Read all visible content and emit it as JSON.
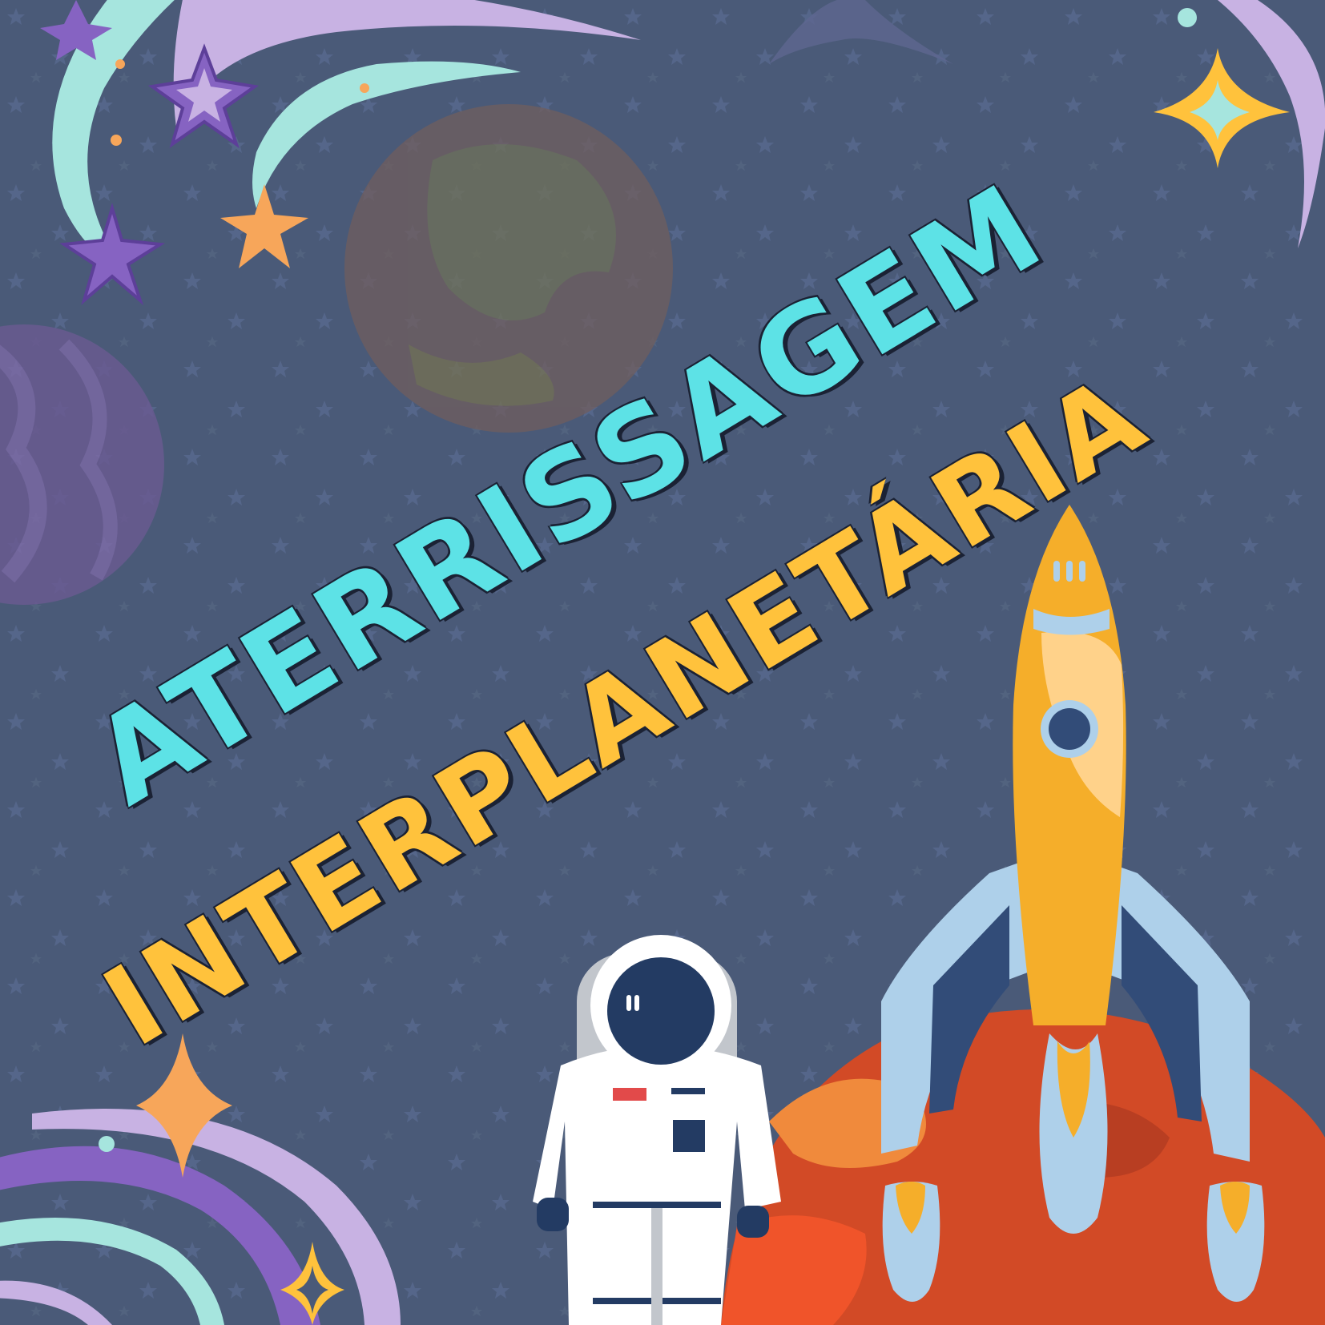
{
  "poster": {
    "title_line_1": "ATERRISSAGEM",
    "title_line_2": "INTERPLANETÁRIA"
  },
  "colors": {
    "background": "#4a5a78",
    "title_line_1": "#5de2e6",
    "title_line_2": "#ffc23c",
    "text_outline": "#1b2234",
    "mint": "#a6e5de",
    "lavender": "#c8b2e3",
    "purple": "#8663c2",
    "star_orange": "#f7a65a",
    "sparkle_yellow": "#ffc23c",
    "mars_red": "#d24a26",
    "rocket_orange": "#f5ae2a",
    "fin_blue": "#aed0ea",
    "suit_white": "#ffffff",
    "visor_navy": "#233b63"
  },
  "icons": [
    "crescent-moon-icon",
    "star-icon",
    "sparkle-icon",
    "planet-icon",
    "rocket-icon",
    "astronaut-icon",
    "flame-icon"
  ]
}
